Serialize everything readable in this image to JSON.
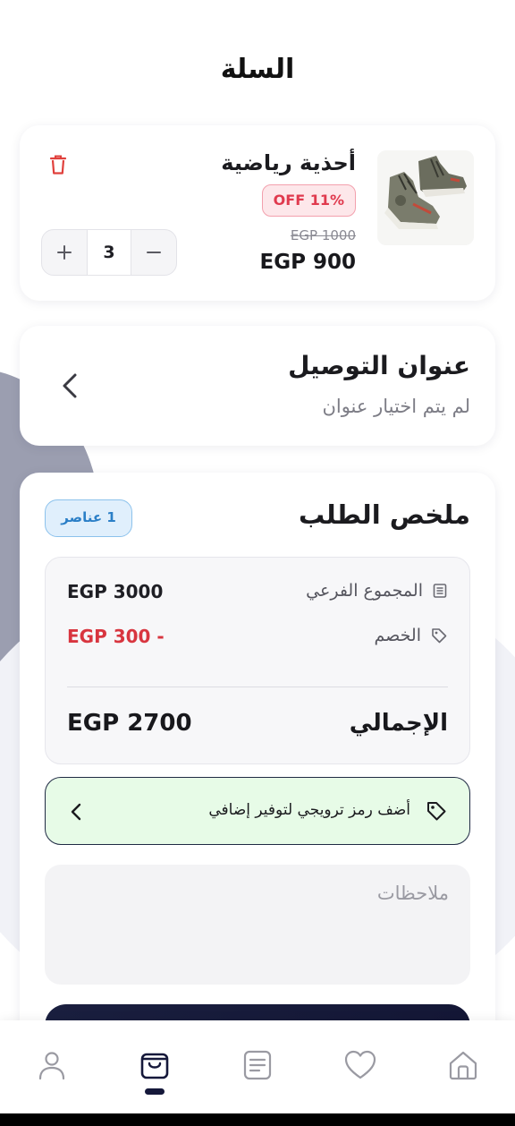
{
  "header": {
    "title": "السلة"
  },
  "product": {
    "name": "أحذية رياضية",
    "discount_badge": "OFF 11%",
    "old_price": "EGP 1000",
    "price": "EGP 900",
    "quantity": "3",
    "image_icon": "sneaker-image"
  },
  "address": {
    "title": "عنوان التوصيل",
    "subtitle": "لم يتم اختيار عنوان"
  },
  "summary": {
    "title": "ملخص الطلب",
    "items_badge": "1 عناصر",
    "subtotal_label": "المجموع الفرعي",
    "subtotal_value": "EGP 3000",
    "discount_label": "الخصم",
    "discount_value": "EGP 300 -",
    "total_label": "الإجمالي",
    "total_value": "EGP 2700"
  },
  "promo": {
    "label": "أضف رمز ترويجي لتوفير إضافي"
  },
  "notes": {
    "placeholder": "ملاحظات"
  },
  "nav": {
    "items": [
      "profile-icon",
      "cart-icon",
      "orders-icon",
      "favorites-icon",
      "home-icon"
    ],
    "active": "cart-icon"
  },
  "colors": {
    "accent_dark": "#15183a",
    "discount_red": "#d8353f",
    "badge_blue": "#2b7fc7",
    "promo_green": "#e7fbe7"
  }
}
